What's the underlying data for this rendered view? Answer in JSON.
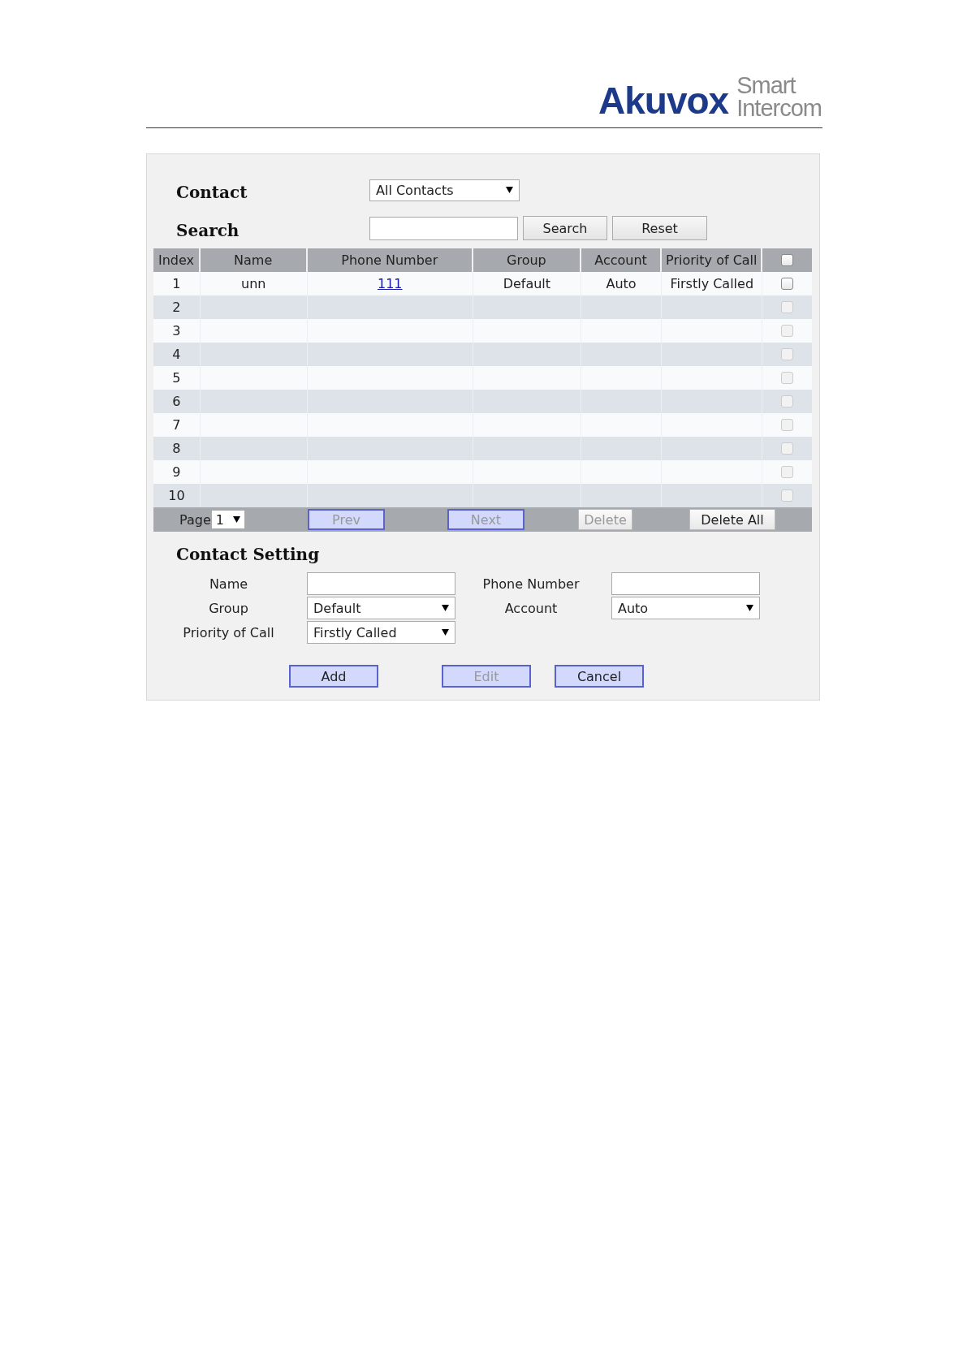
{
  "logo": {
    "brand": "Akuvox",
    "tagline": [
      "Smart",
      "Intercom"
    ]
  },
  "filter": {
    "contact_label": "Contact",
    "contact_value": "All Contacts",
    "search_label": "Search",
    "buttons": [
      {
        "label": "Search",
        "disabled": false
      },
      {
        "label": "Reset",
        "disabled": false
      }
    ]
  },
  "table": {
    "columns": [
      "Index",
      "Name",
      "Phone Number",
      "Group",
      "Account",
      "Priority of Call"
    ],
    "header_checked": false,
    "rows": [
      {
        "index": "1",
        "name": "unn",
        "phone": "111",
        "group": "Default",
        "account": "Auto",
        "priority": "Firstly Called",
        "checked": false,
        "disabled": false
      },
      {
        "index": "2",
        "checked": false,
        "disabled": true
      },
      {
        "index": "3",
        "checked": false,
        "disabled": true
      },
      {
        "index": "4",
        "checked": false,
        "disabled": true
      },
      {
        "index": "5",
        "checked": false,
        "disabled": true
      },
      {
        "index": "6",
        "checked": false,
        "disabled": true
      },
      {
        "index": "7",
        "checked": false,
        "disabled": true
      },
      {
        "index": "8",
        "checked": false,
        "disabled": true
      },
      {
        "index": "9",
        "checked": false,
        "disabled": true
      },
      {
        "index": "10",
        "checked": false,
        "disabled": true
      }
    ]
  },
  "pager": {
    "page_label": "Page",
    "page_value": "1",
    "buttons": [
      {
        "label": "Prev",
        "kind": "nav",
        "disabled": true
      },
      {
        "label": "Next",
        "kind": "nav",
        "disabled": true
      },
      {
        "label": "Delete",
        "kind": "plain",
        "disabled": true
      },
      {
        "label": "Delete All",
        "kind": "plain",
        "disabled": false
      }
    ]
  },
  "contact_setting": {
    "title": "Contact Setting",
    "fields": [
      {
        "label": "Name",
        "kind": "text"
      },
      {
        "label": "Phone Number",
        "kind": "text"
      },
      {
        "label": "Group",
        "kind": "select",
        "value": "Default"
      },
      {
        "label": "Account",
        "kind": "select",
        "value": "Auto"
      },
      {
        "label": "Priority of Call",
        "kind": "select",
        "value": "Firstly Called"
      }
    ],
    "buttons": [
      {
        "label": "Add",
        "disabled": false
      },
      {
        "label": "Edit",
        "disabled": true
      },
      {
        "label": "Cancel",
        "disabled": false
      }
    ]
  }
}
